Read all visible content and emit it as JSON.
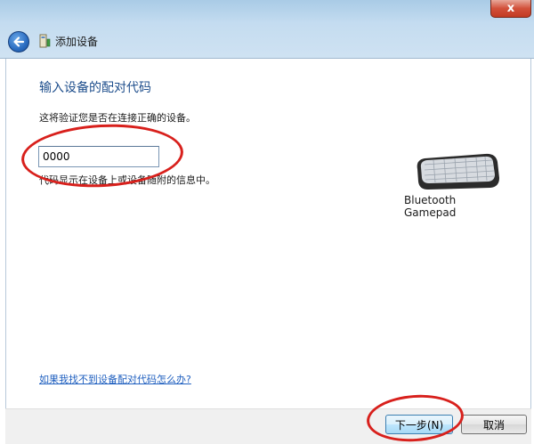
{
  "window": {
    "title": "添加设备",
    "close_glyph": "x"
  },
  "page": {
    "heading": "输入设备的配对代码",
    "description": "这将验证您是否在连接正确的设备。",
    "code_value": "0000",
    "hint": "代码显示在设备上或设备随附的信息中。",
    "help_link": "如果我找不到设备配对代码怎么办?"
  },
  "device": {
    "name": "Bluetooth Gamepad",
    "icon": "keyboard-icon"
  },
  "buttons": {
    "next": "下一步(N)",
    "cancel": "取消"
  },
  "colors": {
    "heading": "#1e4e8c",
    "link": "#1f5fbf",
    "annotation": "#d8201c"
  }
}
